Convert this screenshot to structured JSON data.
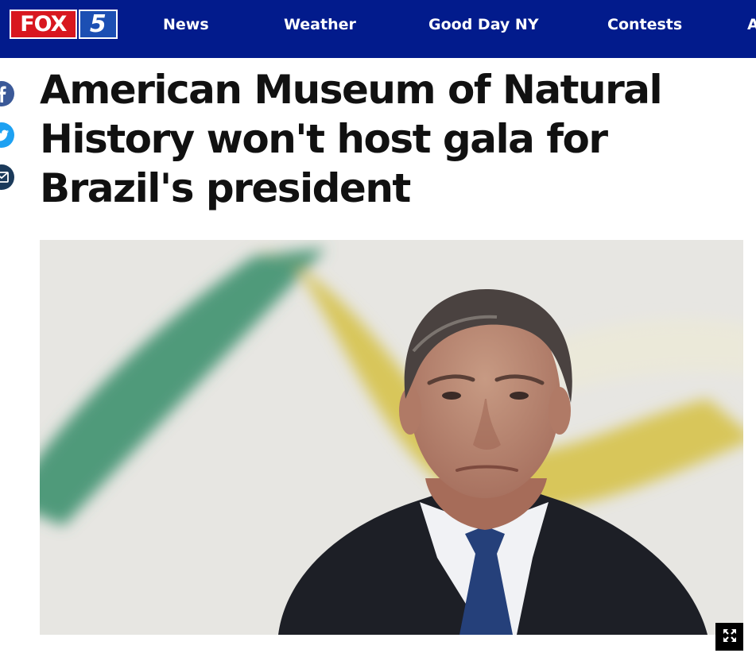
{
  "header": {
    "logo": {
      "brand": "FOX",
      "channel": "5"
    },
    "nav": [
      "News",
      "Weather",
      "Good Day NY",
      "Contests",
      "A"
    ]
  },
  "share": {
    "icons": [
      "facebook-icon",
      "twitter-icon",
      "email-icon"
    ],
    "colors": {
      "facebook": "#3b5998",
      "twitter": "#1da1f2",
      "email": "#1b3a5a"
    }
  },
  "article": {
    "headline": "American Museum of Natural History won't host gala for Brazil's president",
    "hero_expand_icon": "expand-icon"
  },
  "colors": {
    "nav_background": "#021b8c",
    "logo_red": "#d8171f",
    "headline_text": "#111111"
  }
}
